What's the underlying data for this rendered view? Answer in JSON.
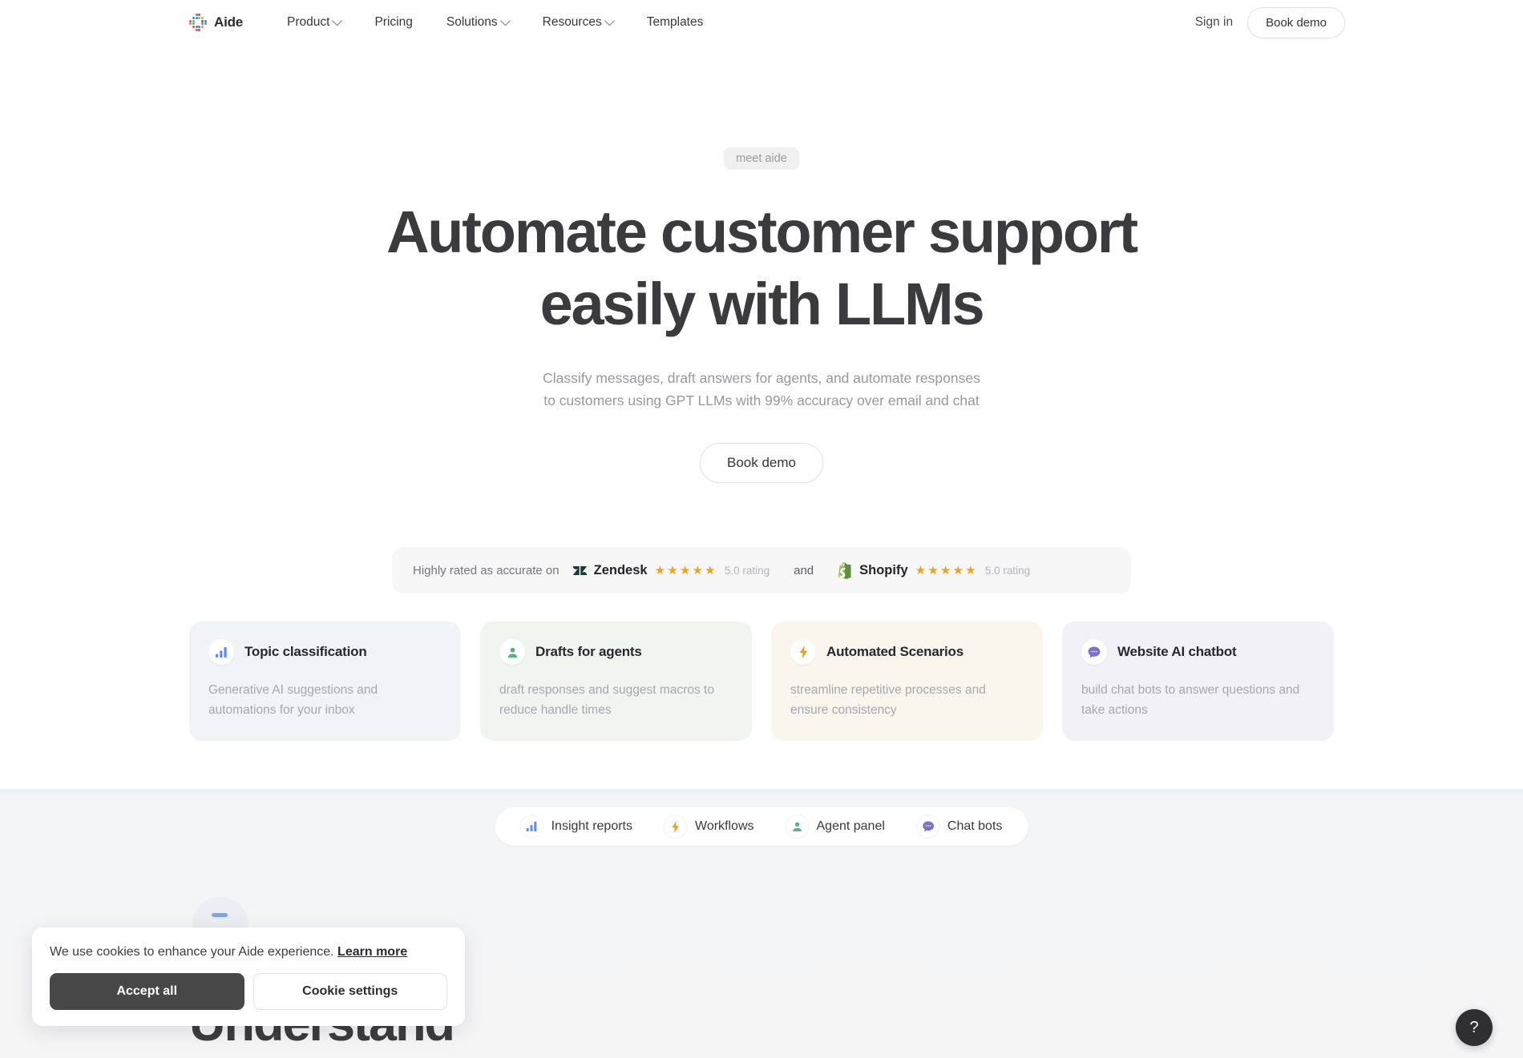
{
  "header": {
    "brand": "Aide",
    "nav": [
      {
        "label": "Product",
        "has_dropdown": true
      },
      {
        "label": "Pricing",
        "has_dropdown": false
      },
      {
        "label": "Solutions",
        "has_dropdown": true
      },
      {
        "label": "Resources",
        "has_dropdown": true
      },
      {
        "label": "Templates",
        "has_dropdown": false
      }
    ],
    "sign_in": "Sign in",
    "book_demo": "Book demo"
  },
  "hero": {
    "eyebrow": "meet aide",
    "title_line1": "Automate customer support",
    "title_line2": "easily with LLMs",
    "subtitle_line1": "Classify messages, draft answers for agents, and automate responses",
    "subtitle_line2": "to customers using GPT LLMs with 99% accuracy over email and chat",
    "cta": "Book demo"
  },
  "ratings": {
    "label": "Highly rated as accurate on",
    "conjunction": "and",
    "items": [
      {
        "brand": "Zendesk",
        "stars": "★★★★★",
        "value": "5.0 rating"
      },
      {
        "brand": "Shopify",
        "stars": "★★★★★",
        "value": "5.0 rating"
      }
    ],
    "star_color": "#e8a525"
  },
  "cards": [
    {
      "icon": "bar-chart-icon",
      "title": "Topic classification",
      "desc": "Generative AI suggestions and automations for your inbox",
      "bg": "#f1f3f7",
      "accent": "#5b8def"
    },
    {
      "icon": "user-icon",
      "title": "Drafts for agents",
      "desc": "draft responses and suggest macros to reduce handle times",
      "bg": "#f1f5f2",
      "accent": "#5eb07f"
    },
    {
      "icon": "lightning-icon",
      "title": "Automated Scenarios",
      "desc": "streamline repetitive processes and ensure consistency",
      "bg": "#faf6ee",
      "accent": "#e3a12b"
    },
    {
      "icon": "chat-bubble-icon",
      "title": "Website AI chatbot",
      "desc": "build chat bots to answer questions and take actions",
      "bg": "#f2f1f7",
      "accent": "#7d6fc4"
    }
  ],
  "pills": [
    {
      "icon": "bar-chart-icon",
      "label": "Insight reports",
      "accent": "#5b8def"
    },
    {
      "icon": "lightning-icon",
      "label": "Workflows",
      "accent": "#e3a12b"
    },
    {
      "icon": "user-icon",
      "label": "Agent panel",
      "accent": "#5eb07f"
    },
    {
      "icon": "chat-bubble-icon",
      "label": "Chat bots",
      "accent": "#7d6fc4"
    }
  ],
  "next_section": {
    "heading": "Understand"
  },
  "cookie": {
    "text": "We use cookies to enhance your Aide experience. ",
    "link": "Learn more",
    "accept": "Accept all",
    "settings": "Cookie settings"
  },
  "help": {
    "glyph": "?"
  },
  "logo_dots": [
    "#d9534f",
    "#6f59c4",
    "#3f8fd4",
    "#2fa37a",
    "#8bc34a",
    "#e0b23a",
    "#c2558a",
    "#4fb0c9",
    "#7a4fbf",
    "#3d7fd0",
    "#e08a3a",
    "#58b36b",
    "#b35ec0",
    "#4a9ad4",
    "#d0543f",
    "#5f6fc4",
    "#2f9e8f",
    "#c9a02f"
  ]
}
